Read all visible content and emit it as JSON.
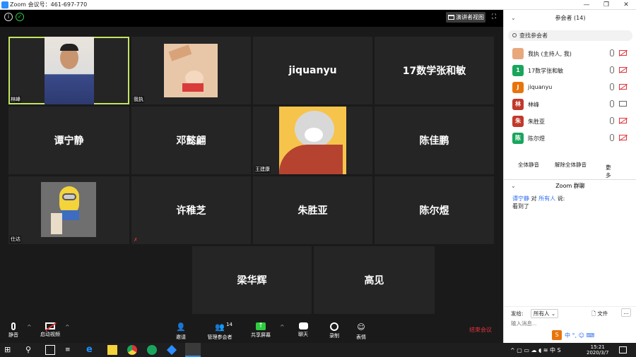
{
  "window": {
    "title": "Zoom 会议号：461-697-770",
    "min": "—",
    "max": "❐",
    "close": "✕"
  },
  "top": {
    "speaker_view": "演讲者视图"
  },
  "tiles": [
    {
      "label": "林峰",
      "name": "",
      "active": true
    },
    {
      "label": "我执",
      "name": ""
    },
    {
      "label": "",
      "name": "jiquanyu"
    },
    {
      "label": "",
      "name": "17数学张和敏"
    },
    {
      "label": "",
      "name": "谭宁静"
    },
    {
      "label": "",
      "name": "邓懿翩"
    },
    {
      "label": "王建康",
      "name": ""
    },
    {
      "label": "",
      "name": "陈佳鹏"
    },
    {
      "label": "仕达",
      "name": ""
    },
    {
      "label": "",
      "name": "许稚芝"
    },
    {
      "label": "",
      "name": "朱胜亚"
    },
    {
      "label": "",
      "name": "陈尔煜"
    },
    {
      "label": "",
      "name": "梁华辉"
    },
    {
      "label": "",
      "name": "高见"
    }
  ],
  "toolbar": {
    "mute": "静音",
    "video": "启动视频",
    "invite": "邀请",
    "participants": "管理参会者",
    "participants_count": "14",
    "share": "共享屏幕",
    "chat": "聊天",
    "record": "录制",
    "reactions": "表情",
    "end": "结束会议"
  },
  "sidebar": {
    "title": "参会者 (14)",
    "search_placeholder": "查找参会者",
    "participants": [
      {
        "name": "我执 (主持人, 我)",
        "avatar": "",
        "color": "#e8a87c"
      },
      {
        "name": "17数学张和敏",
        "avatar": "1",
        "color": "#1aa55d"
      },
      {
        "name": "jiquanyu",
        "avatar": "J",
        "color": "#e8740c"
      },
      {
        "name": "林峰",
        "avatar": "林",
        "color": "#c0392b"
      },
      {
        "name": "朱胜亚",
        "avatar": "朱",
        "color": "#c0392b"
      },
      {
        "name": "陈尔煜",
        "avatar": "陈",
        "color": "#1aa55d"
      }
    ],
    "mute_all": "全体静音",
    "unmute_all": "解除全体静音",
    "more": "更多"
  },
  "chat": {
    "title": "Zoom 群聊",
    "sender": "谭宁静",
    "to_word": "对",
    "recipient": "所有人",
    "said": "说:",
    "message": "看到了",
    "send_to_label": "发给:",
    "send_to_value": "所有人",
    "file": "文件",
    "input_placeholder": "输入消息..."
  },
  "ime": {
    "text": "中 °, ☺ ⌨"
  },
  "clock": {
    "time": "15:21",
    "date": "2020/3/7"
  }
}
